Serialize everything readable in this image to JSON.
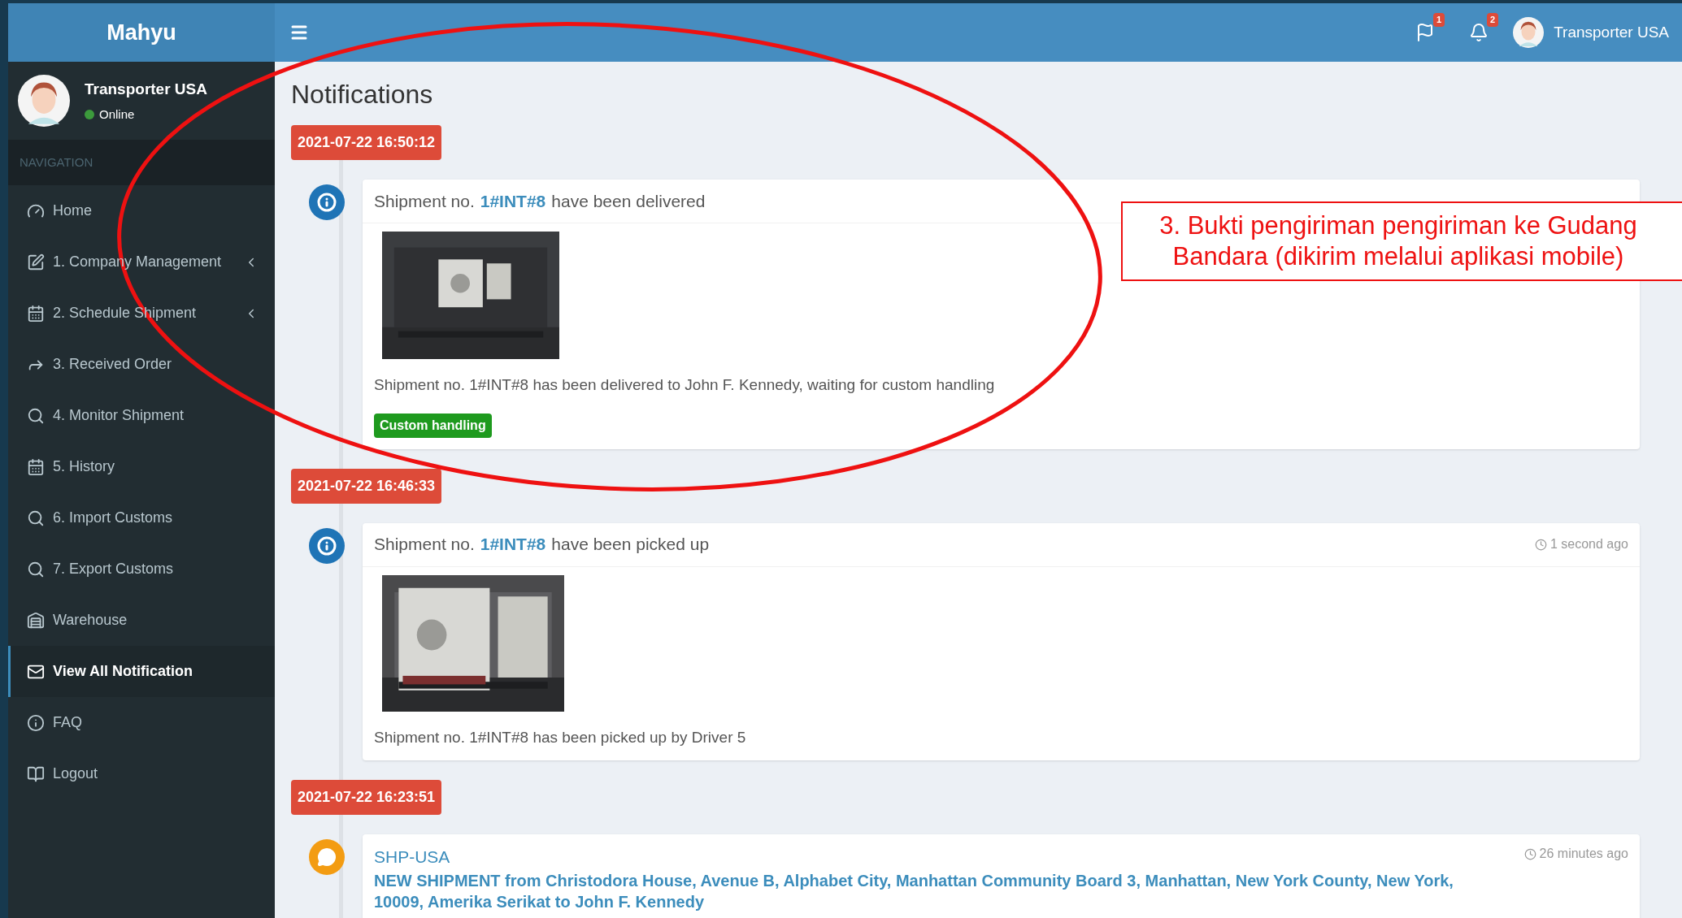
{
  "brand": "Mahyu",
  "user": {
    "name": "Transporter USA",
    "status": "Online"
  },
  "header": {
    "flag_count": "1",
    "bell_count": "2",
    "user_name": "Transporter USA"
  },
  "sidebar": {
    "heading": "NAVIGATION",
    "items": [
      {
        "label": "Home",
        "has_submenu": false,
        "selected": false
      },
      {
        "label": "1. Company Management",
        "has_submenu": true,
        "selected": false
      },
      {
        "label": "2. Schedule Shipment",
        "has_submenu": true,
        "selected": false
      },
      {
        "label": "3. Received Order",
        "has_submenu": false,
        "selected": false
      },
      {
        "label": "4. Monitor Shipment",
        "has_submenu": false,
        "selected": false
      },
      {
        "label": "5. History",
        "has_submenu": false,
        "selected": false
      },
      {
        "label": "6. Import Customs",
        "has_submenu": false,
        "selected": false
      },
      {
        "label": "7. Export Customs",
        "has_submenu": false,
        "selected": false
      },
      {
        "label": "Warehouse",
        "has_submenu": false,
        "selected": false
      },
      {
        "label": "View All Notification",
        "has_submenu": false,
        "selected": true
      },
      {
        "label": "FAQ",
        "has_submenu": false,
        "selected": false
      },
      {
        "label": "Logout",
        "has_submenu": false,
        "selected": false
      }
    ]
  },
  "page_title": "Notifications",
  "timeline": [
    {
      "date": "2021-07-22 16:50:12",
      "items": [
        {
          "kind": "info",
          "title_prefix": "Shipment no.",
          "link": "1#INT#8",
          "title_suffix": "have been delivered",
          "body": "Shipment no. 1#INT#8 has been delivered to John F. Kennedy, waiting for custom handling",
          "badge": "Custom handling"
        }
      ]
    },
    {
      "date": "2021-07-22 16:46:33",
      "items": [
        {
          "kind": "info",
          "title_prefix": "Shipment no.",
          "link": "1#INT#8",
          "title_suffix": "have been picked up",
          "time": "1 second ago",
          "body": "Shipment no. 1#INT#8 has been picked up by Driver 5"
        }
      ]
    },
    {
      "date": "2021-07-22 16:23:51",
      "items": [
        {
          "kind": "comment",
          "link": "SHP-USA",
          "time": "26 minutes ago",
          "message": "NEW SHIPMENT from Christodora House, Avenue B, Alphabet City, Manhattan Community Board 3, Manhattan, New York County, New York, 10009, Amerika Serikat to John F. Kennedy"
        }
      ]
    }
  ],
  "annotation": {
    "text": "3. Bukti pengiriman pengiriman ke Gudang Bandara (dikirim melalui aplikasi mobile)"
  }
}
